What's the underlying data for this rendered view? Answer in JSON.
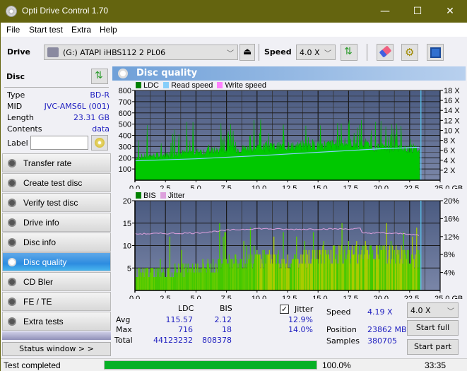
{
  "window": {
    "title": "Opti Drive Control 1.70",
    "minimize": "—",
    "maximize": "☐",
    "close": "✕"
  },
  "menu": [
    "File",
    "Start test",
    "Extra",
    "Help"
  ],
  "toolbar": {
    "drive_label": "Drive",
    "drive_value": "(G:)  ATAPI iHBS112  2 PL06",
    "speed_label": "Speed",
    "speed_value": "4.0 X"
  },
  "disc": {
    "header": "Disc",
    "rows": [
      {
        "label": "Type",
        "value": "BD-R"
      },
      {
        "label": "MID",
        "value": "JVC-AMS6L (001)"
      },
      {
        "label": "Length",
        "value": "23.31 GB"
      },
      {
        "label": "Contents",
        "value": "data"
      }
    ],
    "label_field": "Label",
    "label_value": ""
  },
  "nav": [
    {
      "label": "Transfer rate",
      "active": false
    },
    {
      "label": "Create test disc",
      "active": false
    },
    {
      "label": "Verify test disc",
      "active": false
    },
    {
      "label": "Drive info",
      "active": false
    },
    {
      "label": "Disc info",
      "active": false
    },
    {
      "label": "Disc quality",
      "active": true
    },
    {
      "label": "CD Bler",
      "active": false
    },
    {
      "label": "FE / TE",
      "active": false
    },
    {
      "label": "Extra tests",
      "active": false
    }
  ],
  "status_window_btn": "Status window > >",
  "panel": {
    "title": "Disc quality"
  },
  "chart_data": [
    {
      "type": "area",
      "title": "LDC",
      "legend": [
        "LDC",
        "Read speed",
        "Write speed"
      ],
      "legend_colors": [
        "#008000",
        "#87cefa",
        "#ff80ff"
      ],
      "xlim": [
        0,
        25
      ],
      "x_ticks": [
        "0.0",
        "2.5",
        "5.0",
        "7.5",
        "10.0",
        "12.5",
        "15.0",
        "17.5",
        "20.0",
        "22.5",
        "25.0 GB"
      ],
      "ylim": [
        0,
        800
      ],
      "y_ticks": [
        "100",
        "200",
        "300",
        "400",
        "500",
        "600",
        "700",
        "800"
      ],
      "y2lim": [
        0,
        18
      ],
      "y2_ticks": [
        "2 X",
        "4 X",
        "6 X",
        "8 X",
        "10 X",
        "12 X",
        "14 X",
        "16 X",
        "18 X"
      ],
      "data_end_gb": 23.31,
      "ldc_baseline": [
        [
          0,
          200
        ],
        [
          2.5,
          225
        ],
        [
          5,
          250
        ],
        [
          7.5,
          270
        ],
        [
          10,
          290
        ],
        [
          12.5,
          300
        ],
        [
          15,
          310
        ],
        [
          17.5,
          330
        ],
        [
          20,
          290
        ],
        [
          22.5,
          280
        ],
        [
          23.3,
          270
        ]
      ],
      "ldc_peak_max": 716,
      "read_speed": [
        [
          0,
          3.9
        ],
        [
          5,
          4.3
        ],
        [
          10,
          4.9
        ],
        [
          15,
          5.6
        ],
        [
          20,
          6.3
        ],
        [
          23.3,
          6.6
        ]
      ],
      "grid": true
    },
    {
      "type": "bar",
      "title": "BIS",
      "legend": [
        "BIS",
        "Jitter"
      ],
      "legend_colors": [
        "#008000",
        "#dda0dd"
      ],
      "xlim": [
        0,
        25
      ],
      "x_ticks": [
        "0.0",
        "2.5",
        "5.0",
        "7.5",
        "10.0",
        "12.5",
        "15.0",
        "17.5",
        "20.0",
        "22.5",
        "25.0 GB"
      ],
      "ylim": [
        0,
        20
      ],
      "y_ticks": [
        "5",
        "10",
        "15",
        "20"
      ],
      "y2lim": [
        0,
        20
      ],
      "y2_ticks": [
        "4%",
        "8%",
        "12%",
        "16%",
        "20%"
      ],
      "bis_baseline": [
        [
          0,
          5
        ],
        [
          2.5,
          5
        ],
        [
          5,
          6
        ],
        [
          7.5,
          7
        ],
        [
          10,
          8
        ],
        [
          12.5,
          8
        ],
        [
          15,
          9
        ],
        [
          17.5,
          10
        ],
        [
          20,
          9
        ],
        [
          22.5,
          9
        ],
        [
          23.3,
          8
        ]
      ],
      "bis_peak_max": 18,
      "jitter": [
        [
          0,
          12.6
        ],
        [
          2.5,
          12.7
        ],
        [
          5,
          12.8
        ],
        [
          7.5,
          13.4
        ],
        [
          10,
          13.8
        ],
        [
          12.5,
          13.6
        ],
        [
          15,
          13.7
        ],
        [
          17.5,
          13.7
        ],
        [
          18.5,
          13.8
        ],
        [
          18.6,
          12.8
        ],
        [
          20,
          12.8
        ],
        [
          22.5,
          12.6
        ],
        [
          23.3,
          12.2
        ]
      ],
      "grid": true
    }
  ],
  "stats": {
    "col_ldc": "LDC",
    "col_bis": "BIS",
    "jitter_label": "Jitter",
    "jitter_checked": true,
    "rows": [
      {
        "label": "Avg",
        "ldc": "115.57",
        "bis": "2.12",
        "jitter": "12.9%"
      },
      {
        "label": "Max",
        "ldc": "716",
        "bis": "18",
        "jitter": "14.0%"
      },
      {
        "label": "Total",
        "ldc": "44123232",
        "bis": "808378",
        "jitter": ""
      }
    ],
    "speed_label": "Speed",
    "speed_value": "4.19 X",
    "position_label": "Position",
    "position_value": "23862 MB",
    "samples_label": "Samples",
    "samples_value": "380705",
    "speed_select": "4.0 X",
    "start_full": "Start full",
    "start_part": "Start part"
  },
  "statusbar": {
    "text": "Test completed",
    "progress": 1.0,
    "progress_text": "100.0%",
    "time": "33:35"
  }
}
